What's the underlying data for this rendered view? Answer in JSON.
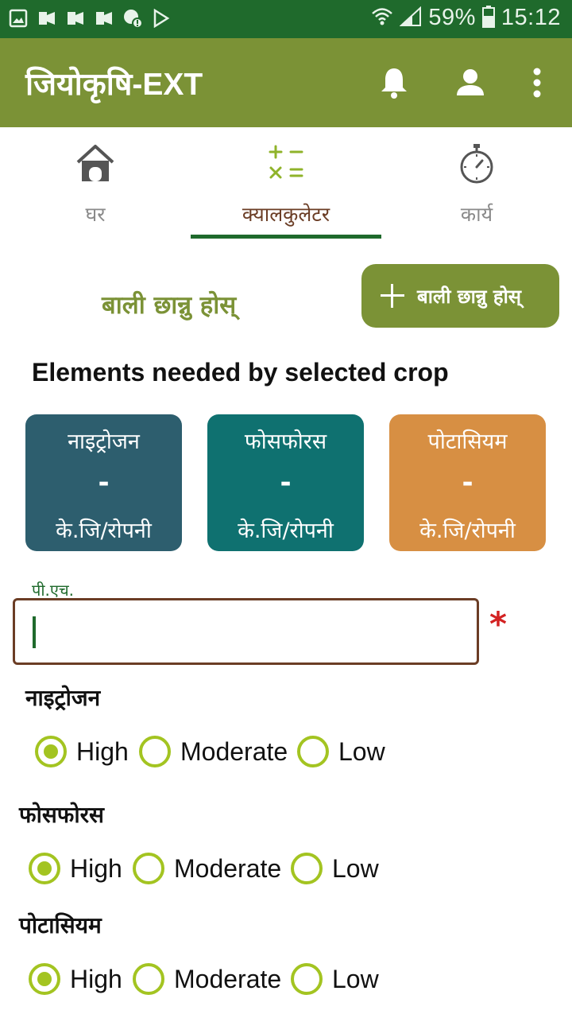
{
  "status_bar": {
    "battery": "59%",
    "time": "15:12"
  },
  "app_bar": {
    "title": "जियोकृषि-EXT"
  },
  "tabs": [
    {
      "label": "घर"
    },
    {
      "label": "क्यालकुलेटर"
    },
    {
      "label": "कार्य"
    }
  ],
  "crop": {
    "title": "बाली छान्नु होस्",
    "add_button_label": "बाली छान्नु होस्"
  },
  "elements_heading": "Elements needed by selected crop",
  "nutrient_cards": [
    {
      "name": "नाइट्रोजन",
      "value": "-",
      "unit": "के.जि/रोपनी",
      "color": "#2d5e6e"
    },
    {
      "name": "फोसफोरस",
      "value": "-",
      "unit": "के.जि/रोपनी",
      "color": "#0f7170"
    },
    {
      "name": "पोटासियम",
      "value": "-",
      "unit": "के.जि/रोपनी",
      "color": "#d78f43"
    }
  ],
  "ph_input": {
    "label": "पी.एच.",
    "value": "",
    "required_mark": "*"
  },
  "soil_levels": [
    {
      "title": "नाइट्रोजन",
      "options": [
        "High",
        "Moderate",
        "Low"
      ],
      "selected": "High"
    },
    {
      "title": "फोसफोरस",
      "options": [
        "High",
        "Moderate",
        "Low"
      ],
      "selected": "High"
    },
    {
      "title": "पोटासियम",
      "options": [
        "High",
        "Moderate",
        "Low"
      ],
      "selected": "High"
    }
  ],
  "colors": {
    "status_bar": "#1f6a2c",
    "app_bar": "#7b9236",
    "accent": "#a3c421",
    "active_tab_text": "#6b3d25"
  }
}
